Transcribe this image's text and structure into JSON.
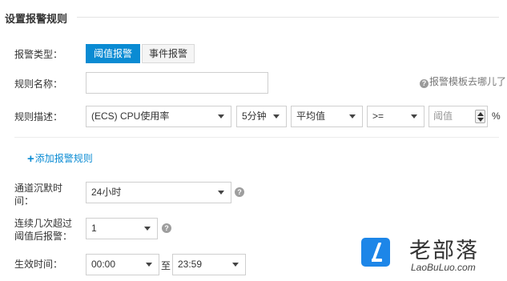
{
  "section": {
    "title": "设置报警规则"
  },
  "alarm_type": {
    "label": "报警类型：",
    "options": [
      "阈值报警",
      "事件报警"
    ],
    "selected": "阈值报警"
  },
  "rule_name": {
    "label": "规则名称：",
    "value": "",
    "help_link": "报警模板去哪儿了"
  },
  "rule_desc": {
    "label": "规则描述：",
    "metric": "(ECS) CPU使用率",
    "period": "5分钟",
    "statistic": "平均值",
    "operator": ">=",
    "threshold_placeholder": "阈值",
    "unit": "%"
  },
  "add_rule": {
    "label": "添加报警规则"
  },
  "channel_silence": {
    "label_line1": "通道沉默时",
    "label_line2": "间：",
    "value": "24小时"
  },
  "consecutive": {
    "label_line1": "连续几次超过",
    "label_line2": "阈值后报警：",
    "value": "1"
  },
  "effective_time": {
    "label": "生效时间：",
    "start": "00:00",
    "to_label": "至",
    "end": "23:59"
  },
  "watermark": {
    "title": "老部落",
    "subtitle": "LaoBuLuo.com"
  },
  "colors": {
    "primary": "#0a8bd3",
    "watermark_blue": "#1d86e8"
  }
}
